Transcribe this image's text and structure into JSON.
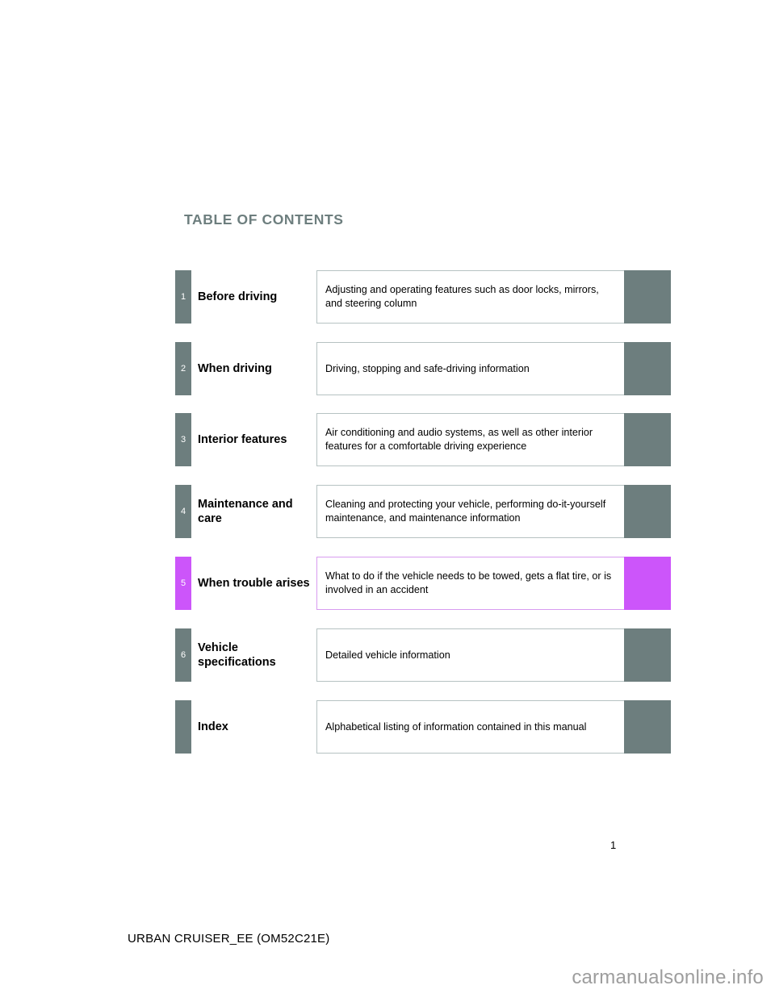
{
  "document": {
    "title": "TABLE OF CONTENTS",
    "page_number": "1",
    "footer_code": "URBAN CRUISER_EE (OM52C21E)",
    "watermark": "carmanualsonline.info"
  },
  "colors": {
    "tab_default": "#6d7e7e",
    "tab_accent": "#cc55fa",
    "title": "#6d7e7e",
    "box_border": "#b6c2c2",
    "box_border_accent": "#d89bf0",
    "text": "#000000",
    "watermark": "#9d9d9d"
  },
  "sections": [
    {
      "number": "1",
      "label": "Before driving",
      "description": "Adjusting and operating features such as door locks, mirrors, and steering column",
      "highlighted": false
    },
    {
      "number": "2",
      "label": "When driving",
      "description": "Driving, stopping and safe-driving information",
      "highlighted": false
    },
    {
      "number": "3",
      "label": "Interior features",
      "description": "Air conditioning and audio systems, as well as other interior features for a comfortable driving experience",
      "highlighted": false
    },
    {
      "number": "4",
      "label": "Maintenance and care",
      "description": "Cleaning and protecting your vehicle, performing do-it-yourself maintenance, and maintenance information",
      "highlighted": false
    },
    {
      "number": "5",
      "label": "When trouble arises",
      "description": "What to do if the vehicle needs to be towed, gets a flat tire, or is involved in an accident",
      "highlighted": true
    },
    {
      "number": "6",
      "label": "Vehicle specifications",
      "description": "Detailed vehicle information",
      "highlighted": false
    },
    {
      "number": "",
      "label": "Index",
      "description": "Alphabetical listing of information contained in this manual",
      "highlighted": false
    }
  ]
}
